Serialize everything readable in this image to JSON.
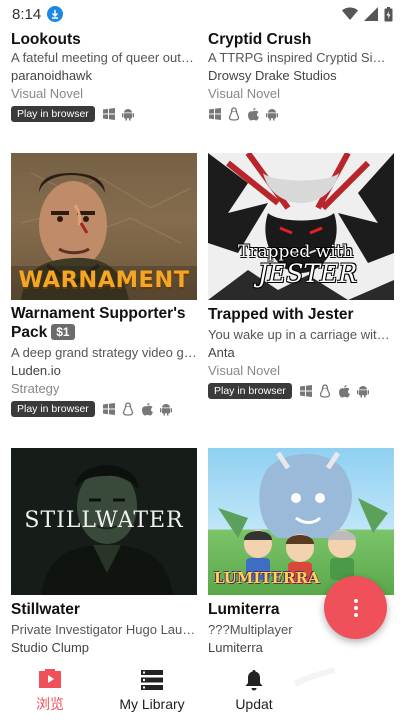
{
  "status": {
    "time": "8:14"
  },
  "cards": [
    {
      "title": "Lookouts",
      "desc": "A fateful meeting of queer outcasts",
      "author": "paranoidhawk",
      "genre": "Visual Novel",
      "browser_badge": "Play in browser",
      "platforms": [
        "windows-icon",
        "android-icon"
      ]
    },
    {
      "title": "Cryptid Crush",
      "desc": "A TTRPG inspired Cryptid Simulator",
      "author": "Drowsy Drake Studios",
      "genre": "Visual Novel",
      "platforms": [
        "windows-icon",
        "linux-icon",
        "apple-icon",
        "android-icon"
      ]
    },
    {
      "title": "Warnament Supporter's Pack",
      "price": "$1",
      "desc": "A deep grand strategy video game",
      "author": "Luden.io",
      "genre": "Strategy",
      "browser_badge": "Play in browser",
      "platforms": [
        "windows-icon",
        "linux-icon",
        "apple-icon",
        "android-icon"
      ],
      "cover_text": "WARNAMENT"
    },
    {
      "title": "Trapped with Jester",
      "desc": "You wake up in a carriage with a jester",
      "author": "Anta",
      "genre": "Visual Novel",
      "browser_badge": "Play in browser",
      "platforms": [
        "windows-icon",
        "linux-icon",
        "apple-icon",
        "android-icon"
      ],
      "cover_text_1": "Trapped with",
      "cover_text_2": "JESTER"
    },
    {
      "title": "Stillwater",
      "desc": "Private Investigator Hugo Laurent",
      "author": "Studio Clump",
      "cover_text": "STILLWATER"
    },
    {
      "title": "Lumiterra",
      "desc": "???Multiplayer",
      "author": "Lumiterra",
      "cover_text": "LUMITERRA"
    }
  ],
  "tabs": [
    {
      "label": "浏览",
      "active": true
    },
    {
      "label": "My Library"
    },
    {
      "label": "Updat"
    }
  ],
  "colors": {
    "accent": "#f0505a",
    "badge": "#3a3a3a"
  }
}
